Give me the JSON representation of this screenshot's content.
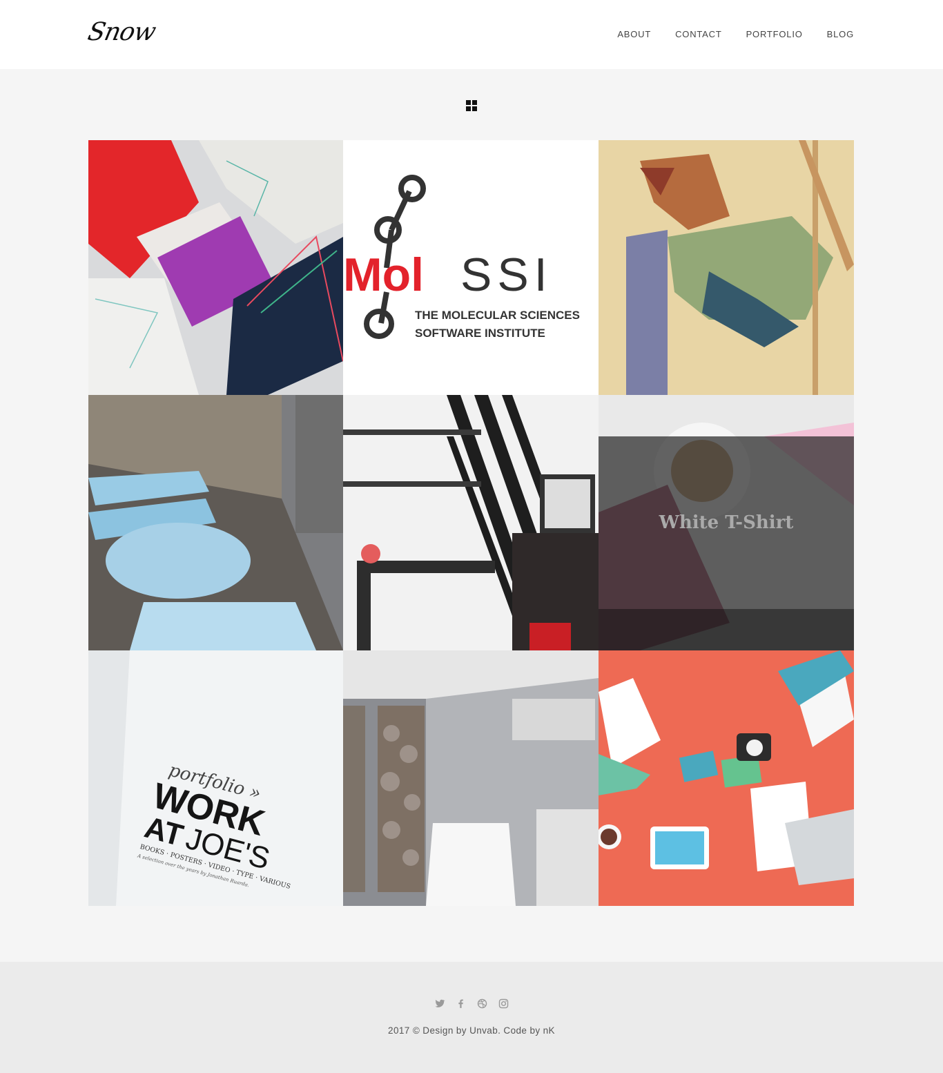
{
  "header": {
    "logo_text": "Snow",
    "nav": [
      "ABOUT",
      "CONTACT",
      "PORTFOLIO",
      "BLOG"
    ]
  },
  "toolbar": {
    "view_icon": "grid-view-icon"
  },
  "portfolio": {
    "items": [
      {
        "kind": "image",
        "description_icon": "posters-photo"
      },
      {
        "kind": "logo",
        "logo_word_red": "Mol",
        "logo_word_dark": "SSI",
        "logo_line1": "THE MOLECULAR SCIENCES",
        "logo_line2": "SOFTWARE INSTITUTE"
      },
      {
        "kind": "image",
        "description_icon": "illustration-photo"
      },
      {
        "kind": "image",
        "description_icon": "workshop-photo"
      },
      {
        "kind": "image",
        "description_icon": "office-photo"
      },
      {
        "kind": "image",
        "overlay_title": "White T-Shirt"
      },
      {
        "kind": "image",
        "book_line1": "portfolio »",
        "book_line2": "WORK",
        "book_line3": "AT",
        "book_line4": "JOE'S",
        "book_line5": "BOOKS · POSTERS · VIDEO · TYPE · VARIOUS",
        "book_line6": "A selection over the years by Jonathan Ruarda."
      },
      {
        "kind": "image",
        "description_icon": "clinic-photo"
      },
      {
        "kind": "image",
        "description_icon": "flat-illustration"
      }
    ]
  },
  "footer": {
    "social_icons": [
      "twitter-icon",
      "facebook-icon",
      "dribbble-icon",
      "instagram-icon"
    ],
    "copyright": "2017 © Design by Unvab. Code by nK"
  },
  "colors": {
    "header_bg": "#ffffff",
    "page_bg": "#f5f5f5",
    "footer_bg": "#ebebeb",
    "molssi_red": "#e3222b",
    "molssi_dark": "#333333"
  }
}
